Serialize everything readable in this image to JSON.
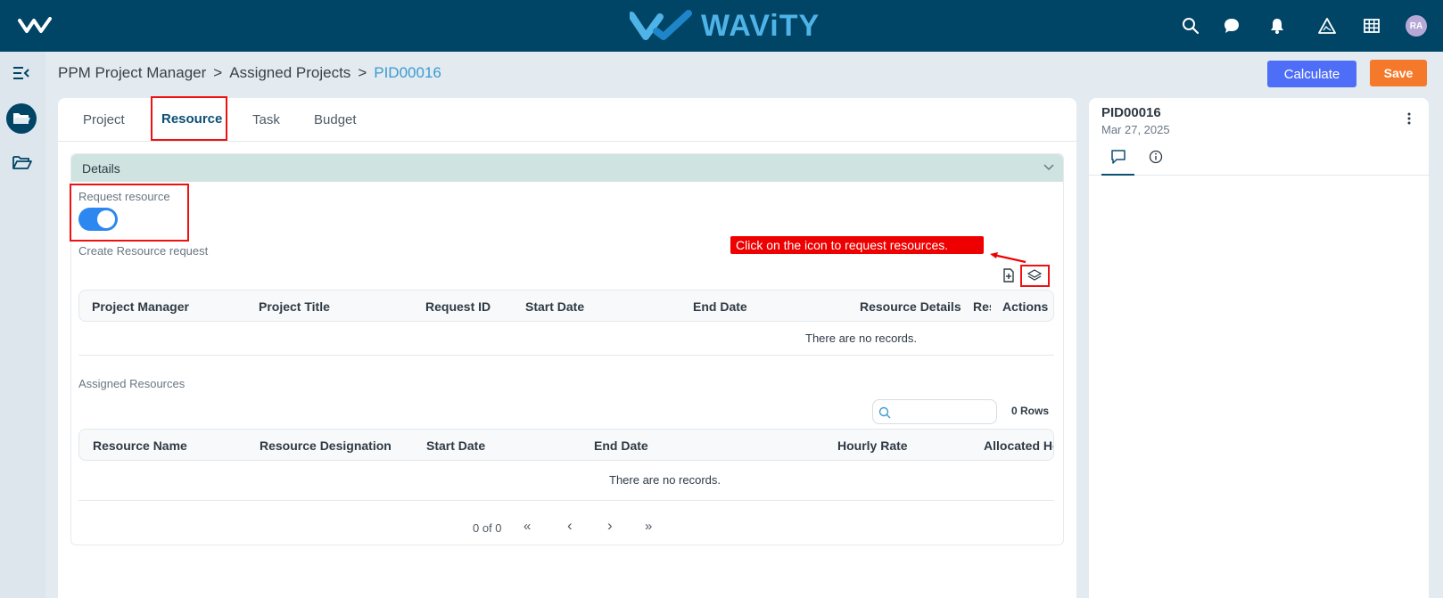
{
  "brand": {
    "name": "WAViTY"
  },
  "topbar": {
    "avatar_initials": "RA"
  },
  "breadcrumb": {
    "items": [
      "PPM Project Manager",
      "Assigned Projects"
    ],
    "current": "PID00016",
    "separator": ">"
  },
  "actions": {
    "calculate_label": "Calculate",
    "save_label": "Save"
  },
  "tabs": [
    {
      "label": "Project",
      "active": false
    },
    {
      "label": "Resource",
      "active": true
    },
    {
      "label": "Task",
      "active": false
    },
    {
      "label": "Budget",
      "active": false
    }
  ],
  "details": {
    "title": "Details",
    "request_resource_label": "Request resource",
    "request_resource_on": true,
    "create_request_label": "Create Resource request",
    "callout": "Click on the icon to request resources.",
    "request_table": {
      "columns": [
        "Project Manager",
        "Project Title",
        "Request ID",
        "Start Date",
        "End Date",
        "Resource Details",
        "Res",
        "Actions"
      ],
      "empty_text": "There are no records."
    },
    "assigned_label": "Assigned Resources",
    "search_placeholder": "",
    "rows_count": "0 Rows",
    "assigned_table": {
      "columns": [
        "Resource Name",
        "Resource Designation",
        "Start Date",
        "End Date",
        "Hourly Rate",
        "Allocated Hou"
      ],
      "empty_text": "There are no records."
    },
    "pagination": {
      "status": "0 of 0",
      "first": "«",
      "prev": "‹",
      "next": "›",
      "last": "»"
    }
  },
  "side_panel": {
    "title": "PID00016",
    "date": "Mar 27, 2025"
  },
  "colors": {
    "topbar": "#004466",
    "accent": "#3a9bd1",
    "calculate": "#4f6ef7",
    "save": "#f5792a",
    "highlight": "#ee0000"
  }
}
